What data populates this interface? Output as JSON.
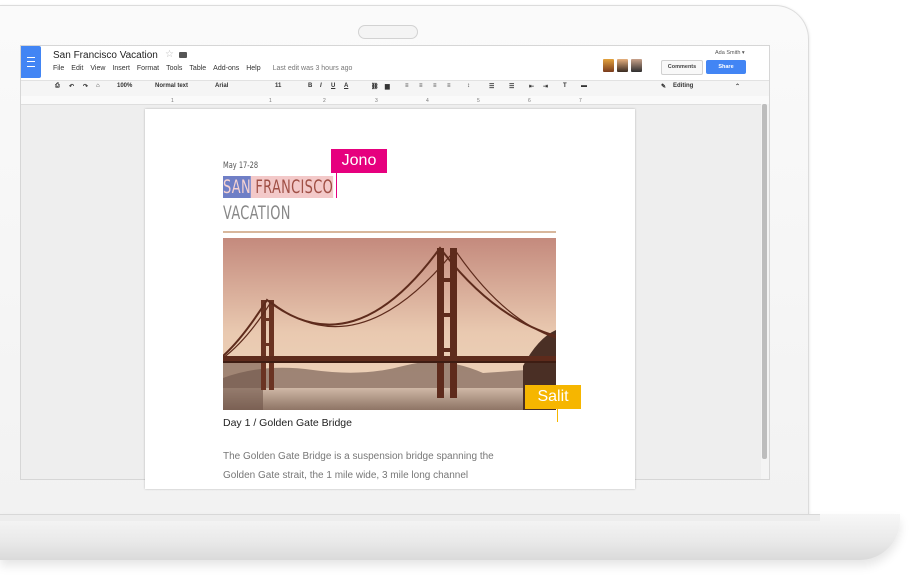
{
  "app": {
    "doc_title": "San Francisco Vacation",
    "user_name": "Ada Smith ▾",
    "last_edit": "Last edit was 3 hours ago",
    "menu": [
      "File",
      "Edit",
      "View",
      "Insert",
      "Format",
      "Tools",
      "Table",
      "Add-ons",
      "Help"
    ],
    "comments_label": "Comments",
    "share_label": "Share",
    "accent_color": "#4285f4"
  },
  "toolbar": {
    "zoom": "100%",
    "style": "Normal text",
    "font": "Arial",
    "size": "11",
    "mode": "Editing"
  },
  "ruler": [
    "1",
    "1",
    "2",
    "3",
    "4",
    "5",
    "6",
    "7"
  ],
  "document": {
    "date": "May 17-28",
    "title_part1": "SAN",
    "title_part2": " FRANCISCO",
    "title_line2": "VACATION",
    "caption": "Day 1 / Golden Gate Bridge",
    "body_line1": "The Golden Gate Bridge is a suspension bridge spanning the",
    "body_line2": "Golden Gate strait, the 1 mile wide, 3 mile long channel"
  },
  "collaborators": {
    "jono": {
      "name": "Jono",
      "color": "#e6007e"
    },
    "salit": {
      "name": "Salit",
      "color": "#f6b600"
    }
  }
}
